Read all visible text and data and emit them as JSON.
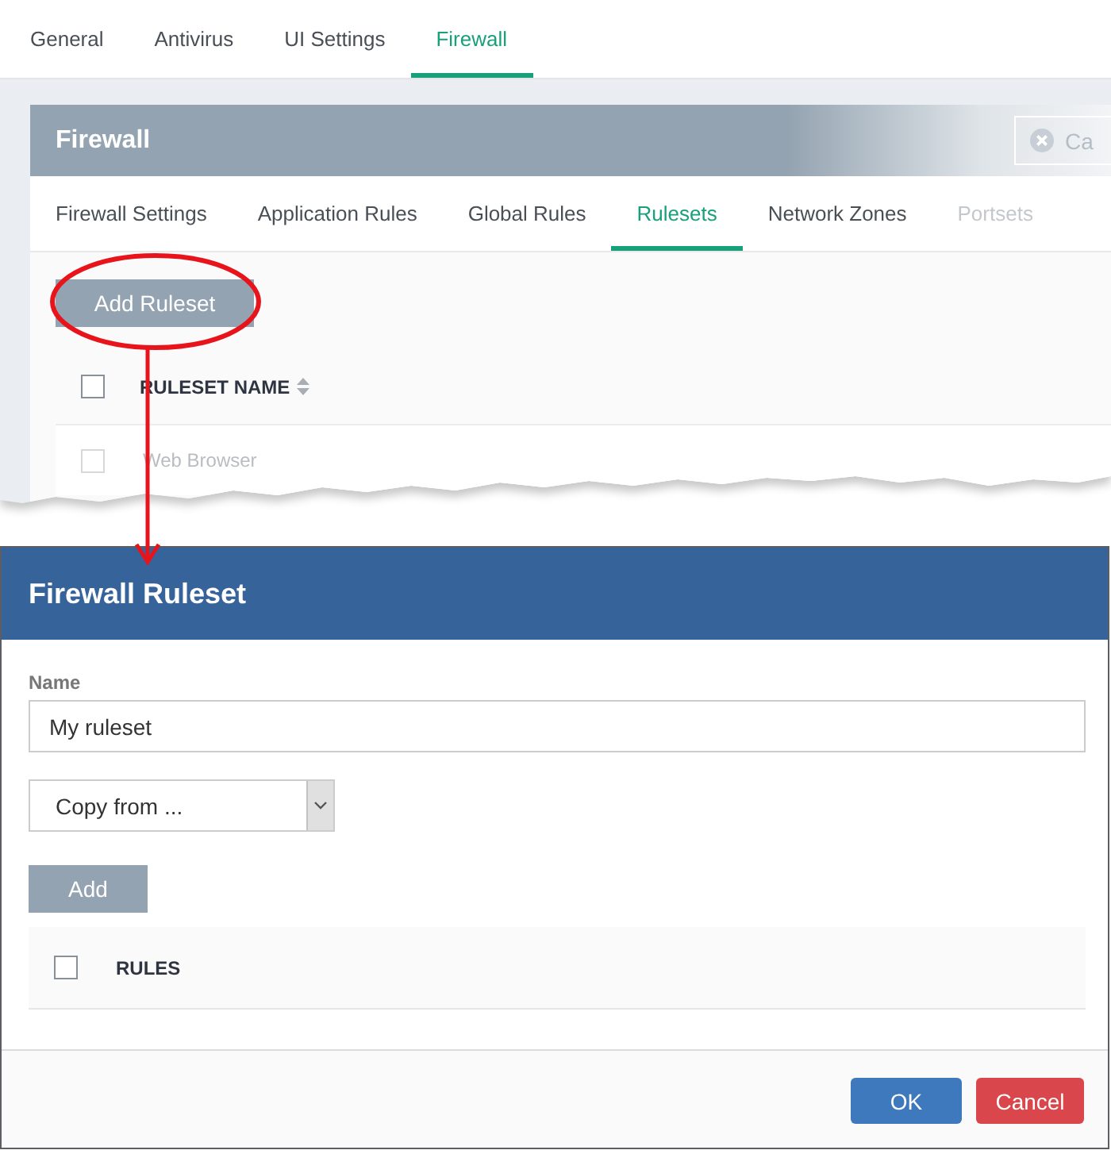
{
  "page_tabs": [
    {
      "label": "General",
      "selected": false
    },
    {
      "label": "Antivirus",
      "selected": false
    },
    {
      "label": "UI Settings",
      "selected": false
    },
    {
      "label": "Firewall",
      "selected": true
    }
  ],
  "firewall_panel": {
    "title": "Firewall",
    "header_button": "Ca",
    "tabs": [
      {
        "label": "Firewall Settings",
        "selected": false,
        "disabled": false
      },
      {
        "label": "Application Rules",
        "selected": false,
        "disabled": false
      },
      {
        "label": "Global Rules",
        "selected": false,
        "disabled": false
      },
      {
        "label": "Rulesets",
        "selected": true,
        "disabled": false
      },
      {
        "label": "Network Zones",
        "selected": false,
        "disabled": false
      },
      {
        "label": "Portsets",
        "selected": false,
        "disabled": true
      }
    ],
    "add_button": "Add Ruleset",
    "table": {
      "header_checked": false,
      "columns": [
        {
          "label": "RULESET NAME",
          "sortable": true
        }
      ],
      "rows": [
        {
          "name": "Web Browser",
          "checked": false
        }
      ]
    }
  },
  "dialog": {
    "title": "Firewall Ruleset",
    "name_field": {
      "label": "Name",
      "value": "My ruleset"
    },
    "copy_select": {
      "value": "Copy from ..."
    },
    "add_button": "Add",
    "rules_table": {
      "header_checked": false,
      "columns": [
        {
          "label": "RULES",
          "sortable": false
        }
      ]
    },
    "buttons": [
      {
        "label": "OK",
        "kind": "primary"
      },
      {
        "label": "Cancel",
        "kind": "danger"
      }
    ]
  }
}
